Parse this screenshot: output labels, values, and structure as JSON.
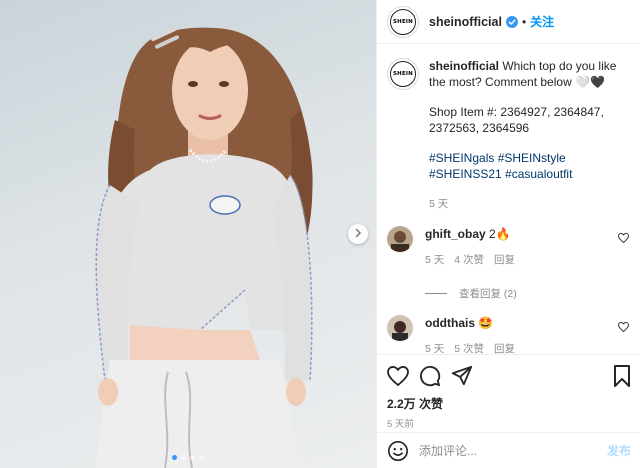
{
  "post": {
    "username": "sheinofficial",
    "avatar_logo": "SHEIN",
    "follow_separator": "•",
    "follow_label": "关注"
  },
  "caption": {
    "username": "sheinofficial",
    "text": "Which top do you like the most? Comment below",
    "emoji": "🤍🖤",
    "shop_items": "Shop Item #: 2364927, 2364847, 2372563, 2364596",
    "hashtags": "#SHEINgals #SHEINstyle #SHEINSS21 #casualoutfit",
    "time": "5 天"
  },
  "comments": [
    {
      "username": "ghift_obay",
      "text": "2🔥",
      "time": "5 天",
      "likes": "4 次赞",
      "reply": "回复"
    },
    {
      "username": "oddthais",
      "text": "🤩",
      "time": "5 天",
      "likes": "5 次赞",
      "reply": "回复"
    }
  ],
  "view_replies": "查看回复 (2)",
  "stats": {
    "likes": "2.2万 次赞",
    "date": "5 天前"
  },
  "composer": {
    "placeholder": "添加评论...",
    "post_label": "发布"
  },
  "carousel": {
    "count": 4,
    "active_index": 0
  },
  "colors": {
    "accent": "#0095f6",
    "verified": "#3897f0",
    "hashtag": "#00376b",
    "muted": "#8e8e8e"
  },
  "icons": [
    "verified-badge-icon",
    "heart-icon",
    "comment-icon",
    "share-icon",
    "bookmark-icon",
    "emoji-icon",
    "chevron-right-icon"
  ]
}
